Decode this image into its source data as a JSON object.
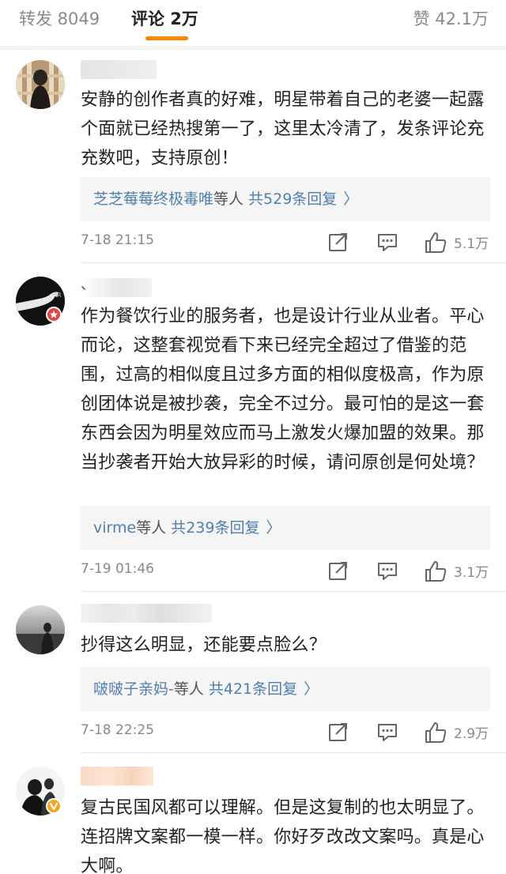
{
  "tabs": {
    "repost": "转发 8049",
    "comments": "评论 2万",
    "likes": "赞 42.1万"
  },
  "colors": {
    "accent": "#ff8200",
    "link": "#4f7fae",
    "verified": "#f5a623",
    "vip_red": "#e2473f"
  },
  "comments": [
    {
      "text": "安静的创作者真的好难，明星带着自己的老婆一起露个面就已经热搜第一了，这里太冷清了，发条评论充充数吧，支持原创！",
      "reply_names": "芝芝莓莓终极毒唯",
      "reply_et": "等人",
      "reply_count": "共529条回复",
      "reply_chevron": "〉",
      "time": "7-18 21:15",
      "likes": "5.1万"
    },
    {
      "username": "、",
      "text": "作为餐饮行业的服务者，也是设计行业从业者。平心而论，这整套视觉看下来已经完全超过了借鉴的范围，过高的相似度且过多方面的相似度极高，作为原创团体说是被抄袭，完全不过分。最可怕的是这一套东西会因为明星效应而马上激发火爆加盟的效果。那当抄袭者开始大放异彩的时候，请问原创是何处境？",
      "reply_names": "virme",
      "reply_et": "等人",
      "reply_count": "共239条回复",
      "reply_chevron": "〉",
      "time": "7-19 01:46",
      "likes": "3.1万"
    },
    {
      "text": "抄得这么明显，还能要点脸么？",
      "reply_names": "啵啵子亲妈-",
      "reply_et": "等人",
      "reply_count": "共421条回复",
      "reply_chevron": "〉",
      "time": "7-18 22:25",
      "likes": "2.9万"
    },
    {
      "text": "复古民国风都可以理解。但是这复制的也太明显了。连招牌文案都一模一样。你好歹改改文案吗。真是心大啊。"
    }
  ]
}
